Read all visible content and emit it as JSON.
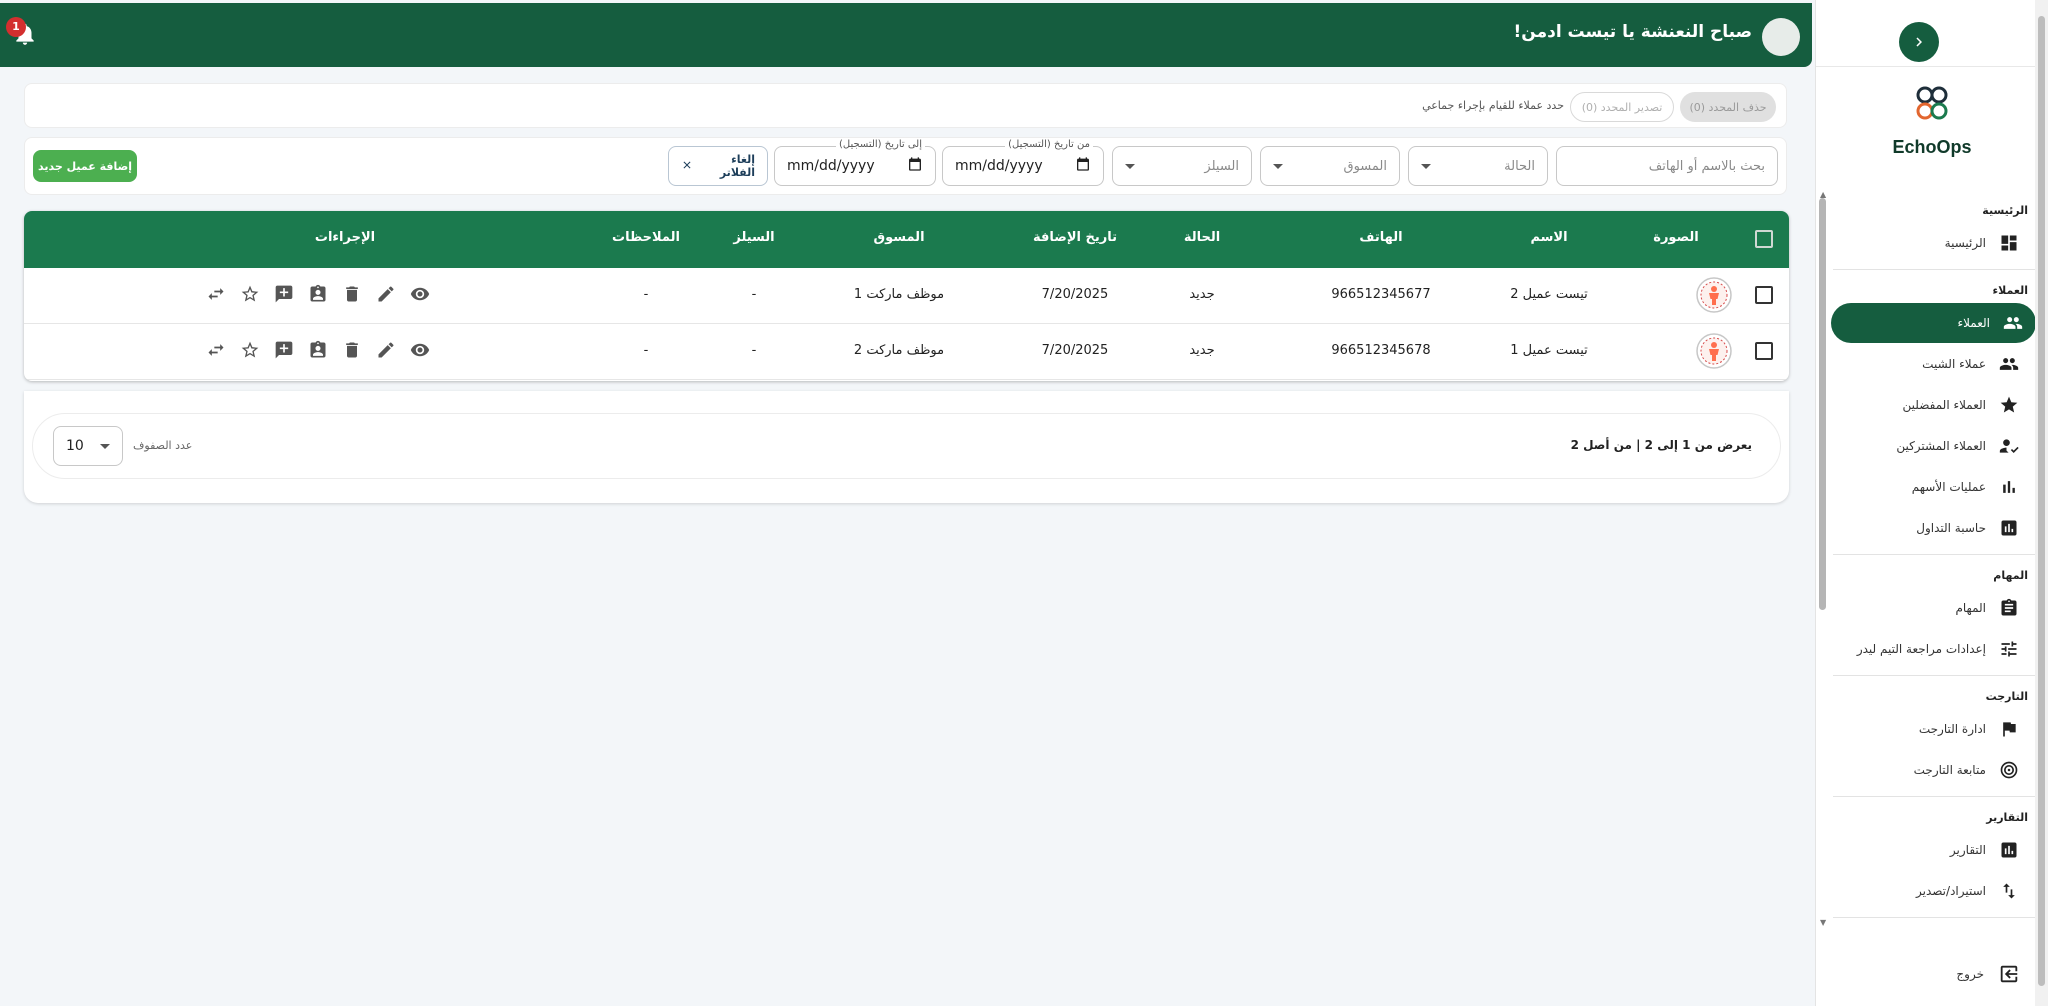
{
  "app": {
    "name": "EchoOps"
  },
  "header": {
    "greeting": "صباح النعنشة يا تيست ادمن!",
    "notifications_count": "1"
  },
  "sidebar": {
    "sections": [
      {
        "title": "الرئيسية",
        "items": [
          {
            "label": "الرئيسية",
            "icon": "dashboard-icon"
          }
        ]
      },
      {
        "title": "العملاء",
        "items": [
          {
            "label": "العملاء",
            "icon": "people-icon",
            "active": true
          },
          {
            "label": "عملاء الشيت",
            "icon": "people-icon"
          },
          {
            "label": "العملاء المفضلين",
            "icon": "star-icon"
          },
          {
            "label": "العملاء المشتركين",
            "icon": "person-check-icon"
          },
          {
            "label": "عمليات الأسهم",
            "icon": "bar-chart-icon"
          },
          {
            "label": "حاسبة التداول",
            "icon": "calculator-chart-icon"
          }
        ]
      },
      {
        "title": "المهام",
        "items": [
          {
            "label": "المهام",
            "icon": "clipboard-icon"
          },
          {
            "label": "إعدادات مراجعة التيم ليدر",
            "icon": "tune-icon"
          }
        ]
      },
      {
        "title": "التارجت",
        "items": [
          {
            "label": "ادارة التارجت",
            "icon": "flag-icon"
          },
          {
            "label": "متابعة التارجت",
            "icon": "target-icon"
          }
        ]
      },
      {
        "title": "التقارير",
        "items": [
          {
            "label": "التقارير",
            "icon": "report-icon"
          },
          {
            "label": "استيراد/تصدير",
            "icon": "import-export-icon"
          }
        ]
      }
    ],
    "logout": "خروج"
  },
  "bulk": {
    "delete_label": "حذف المحدد (0)",
    "export_label": "تصدير المحدد (0)",
    "hint": "حدد عملاء للقيام بإجراء جماعي"
  },
  "filters": {
    "search_placeholder": "بحث بالاسم أو الهاتف",
    "status_label": "الحالة",
    "marketer_label": "المسوق",
    "sales_label": "السيلز",
    "from_date_label": "من تاريخ (التسجيل)",
    "to_date_label": "إلى تاريخ (التسجيل)",
    "date_placeholder": "mm/dd/yyyy",
    "clear_label": "إلغاء الفلاتر",
    "add_client_label": "إضافة عميل جديد"
  },
  "table": {
    "columns": {
      "photo": "الصورة",
      "name": "الاسم",
      "phone": "الهاتف",
      "status": "الحالة",
      "date_added": "تاريخ الإضافة",
      "marketer": "المسوق",
      "sales": "السيلز",
      "notes": "الملاحظات",
      "actions": "الإجراءات"
    },
    "rows": [
      {
        "name": "تيست عميل 2",
        "phone": "966512345677",
        "status": "جديد",
        "date_added": "7/20/2025",
        "marketer": "موظف ماركت 1",
        "sales": "-",
        "notes": "-"
      },
      {
        "name": "تيست عميل 1",
        "phone": "966512345678",
        "status": "جديد",
        "date_added": "7/20/2025",
        "marketer": "موظف ماركت 2",
        "sales": "-",
        "notes": "-"
      }
    ]
  },
  "pagination": {
    "info": "يعرض من 1 إلى 2 | من أصل 2",
    "rows_label": "عدد الصفوف",
    "rows_value": "10"
  },
  "colors": {
    "primary": "#155d3f",
    "table_header": "#1b7a4e",
    "add_button": "#4caf50",
    "badge": "#d32f2f"
  }
}
